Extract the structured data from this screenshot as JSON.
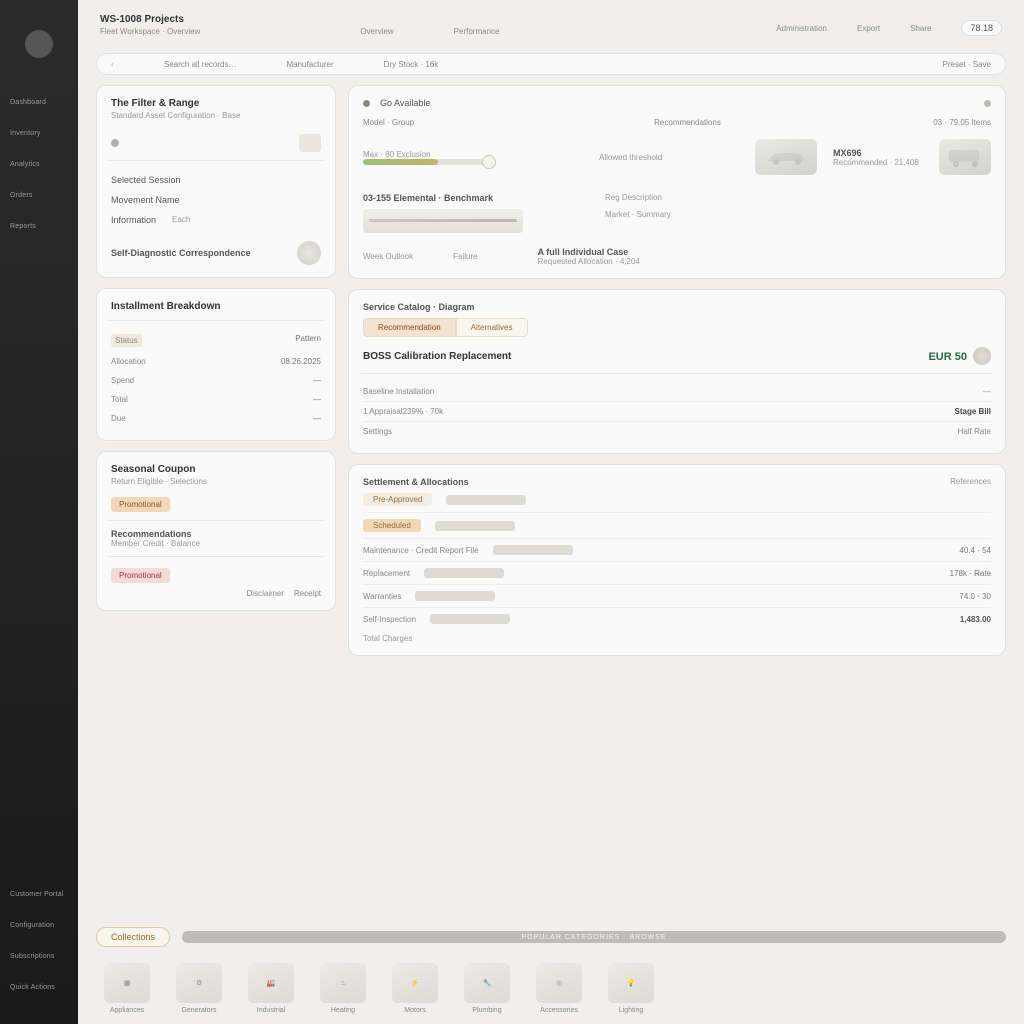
{
  "sidebar": {
    "items": [
      "Dashboard",
      "Inventory",
      "Analytics",
      "Orders",
      "Reports"
    ],
    "footer": [
      "Customer Portal",
      "Configuration",
      "Subscriptions",
      "Quick Actions"
    ]
  },
  "header": {
    "title": "WS-1008 Projects",
    "subtitle": "Fleet Workspace · Overview",
    "mid": [
      "Overview",
      "Performance"
    ],
    "right_a": "Administration",
    "right_b": "Export",
    "right_c": "Share",
    "pill": "78.18"
  },
  "filter": {
    "chev": "‹",
    "f1": "Search all records…",
    "f2": "Manufacturer",
    "f3": "Dry Stock · 16k",
    "right": "Preset · Save"
  },
  "cardA": {
    "title": "The Filter & Range",
    "sub": "Standard Asset Configuration · Base",
    "l1": "Selected Session",
    "l2": "Movement Name",
    "l3": "Information",
    "l3v": "Each",
    "foot": "Self-Diagnostic Correspondence"
  },
  "cardB": {
    "hd": "Go Available",
    "col1": "Model · Group",
    "col2": "Recommendations",
    "col3": "03 · 79.05 Items",
    "s1_label": "Max · 80 Exclusion",
    "s1_note": "Allowed threshold",
    "veh1": "MX696",
    "veh1_sub": "Recommended · 21,408",
    "row2_title": "03-155 Elemental · Benchmark",
    "row2_a": "Reg Description",
    "row2_b": "Market · Summary",
    "ft_a": "Week Outlook",
    "ft_av": "Failure",
    "ft_b": "A full Individual Case",
    "ft_bsub": "Requested Allocation · 4,204"
  },
  "cardC": {
    "title": "Installment Breakdown",
    "rows": [
      {
        "k": "Status",
        "v": "Pattern"
      },
      {
        "k": "Allocation",
        "v": "08.26.2025"
      },
      {
        "k": "Spend",
        "v": "—"
      },
      {
        "k": "Total",
        "v": "—"
      },
      {
        "k": "Due",
        "v": "—"
      }
    ]
  },
  "cardD": {
    "title": "Seasonal Coupon",
    "sub": "Return Eligible · Selections",
    "chip": "Promotional",
    "h2": "Recommendations",
    "h2s": "Member Credit · Balance",
    "foot_l": "Disclaimer",
    "foot_r": "Receipt"
  },
  "cardE": {
    "title": "Service Catalog · Diagram",
    "tab1": "Recommendation",
    "tab2": "Alternatives",
    "price_name": "BOSS Calibration Replacement",
    "price_val": "EUR 50",
    "row_a": "Baseline Installation",
    "row_b": "1 Appraisal",
    "row_b_v": "239% · 70k",
    "row_b_r": "Stage Bill",
    "row_c": "Settings",
    "row_c_r": "Half Rate"
  },
  "cardF": {
    "title": "Settlement & Allocations",
    "hd_r": "References",
    "rows": [
      {
        "tag": "Pre-Approved",
        "txt": "",
        "amt": ""
      },
      {
        "tag": "Scheduled",
        "txt": "",
        "amt": ""
      },
      {
        "tag": "",
        "txt": "Maintenance · Credit Report File",
        "amt": "40.4 · 54"
      },
      {
        "tag": "",
        "txt": "Replacement",
        "amt": "178k · Rate"
      },
      {
        "tag": "",
        "txt": "Warranties",
        "amt": "74.0 · 30"
      },
      {
        "tag": "",
        "txt": "Self-Inspection",
        "amt": "1,483.00"
      }
    ],
    "foot": "Total Charges"
  },
  "catbar": {
    "pill": "Collections",
    "banner": "POPULAR CATEGORIES · BROWSE",
    "items": [
      "Appliances",
      "Generators",
      "Industrial",
      "Heating",
      "Motors",
      "Plumbing",
      "Accessories",
      "Lighting"
    ]
  }
}
